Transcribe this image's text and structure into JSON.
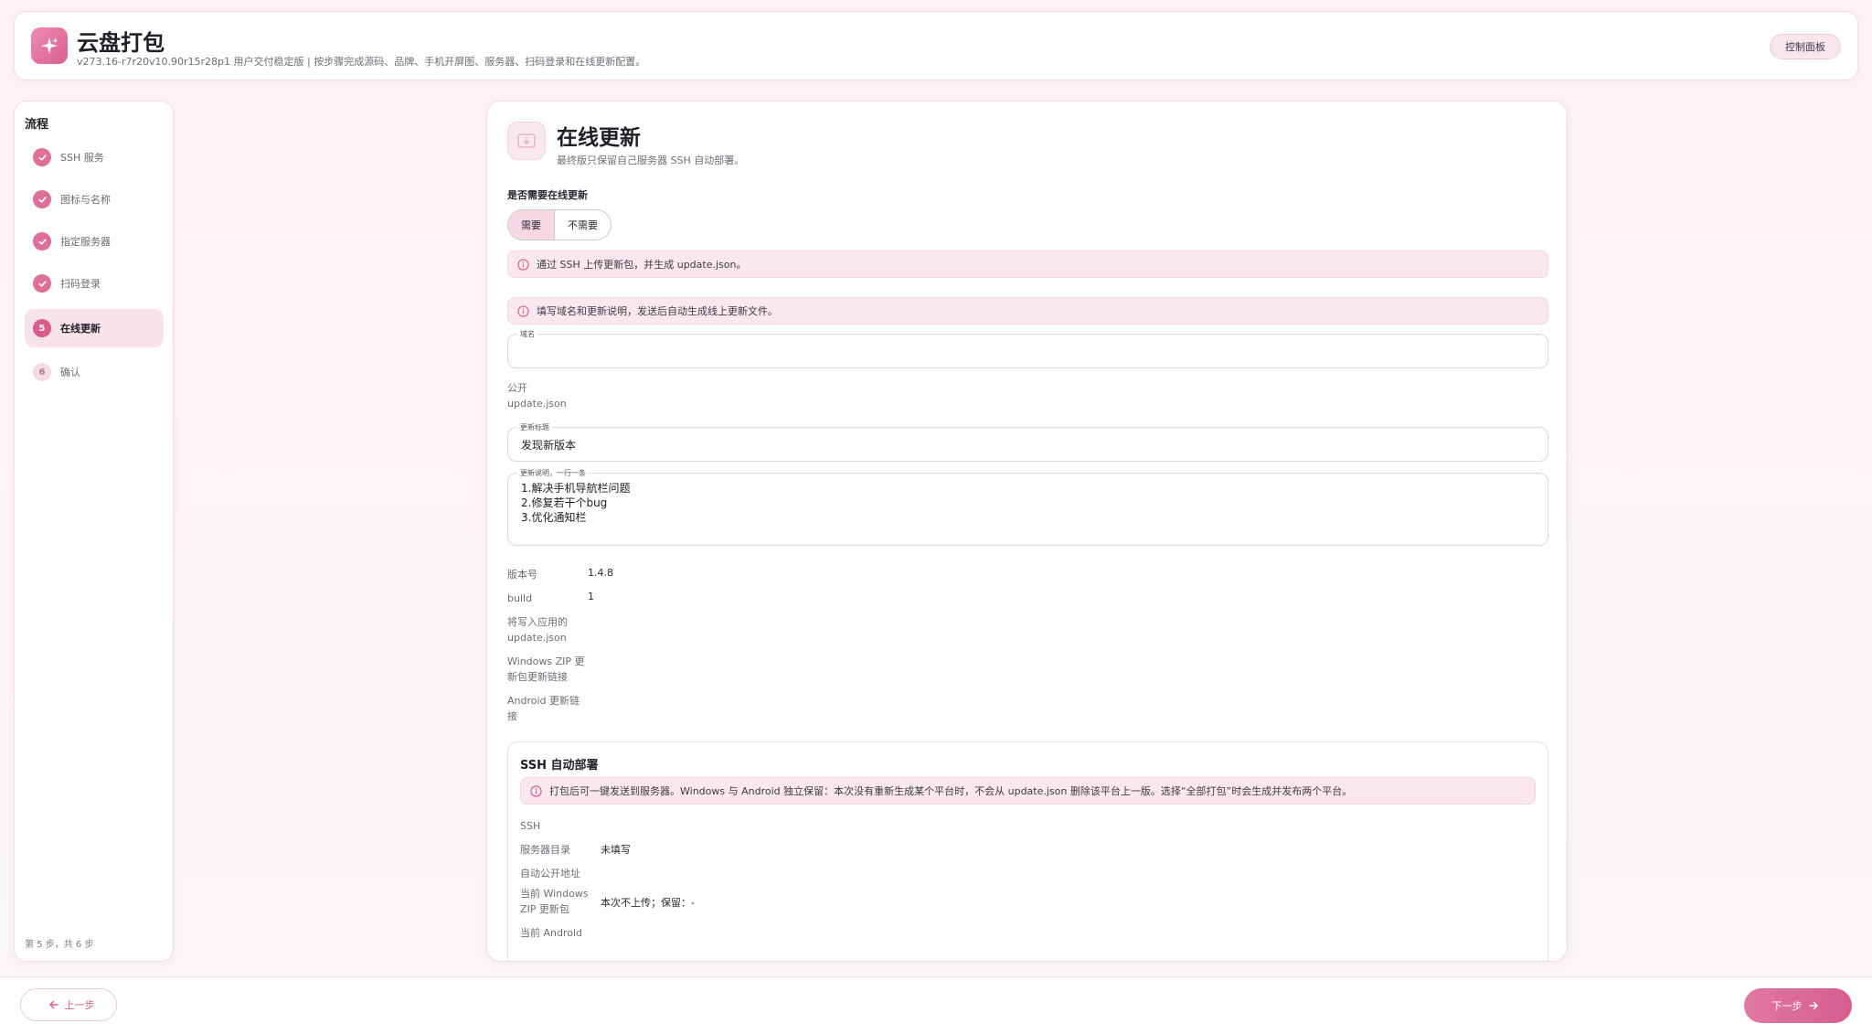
{
  "header": {
    "title": "云盘打包",
    "subtitle": "v273.16-r7r20v10.90r15r28p1 用户交付稳定版 | 按步骤完成源码、品牌、手机开屏图、服务器、扫码登录和在线更新配置。",
    "dashboard_label": "控制面板"
  },
  "sidebar": {
    "title": "流程",
    "steps": [
      {
        "label": "SSH 服务",
        "status": "done"
      },
      {
        "label": "图标与名称",
        "status": "done"
      },
      {
        "label": "指定服务器",
        "status": "done"
      },
      {
        "label": "扫码登录",
        "status": "done"
      },
      {
        "number": "5",
        "label": "在线更新",
        "status": "current"
      },
      {
        "number": "6",
        "label": "确认",
        "status": "todo"
      }
    ],
    "progress": "第 5 步，共 6 步"
  },
  "main": {
    "title": "在线更新",
    "subtitle": "最终版只保留自己服务器 SSH 自动部署。",
    "question": "是否需要在线更新",
    "options": [
      "需要",
      "不需要"
    ],
    "selected_option": "需要",
    "alert1": "通过 SSH 上传更新包，并生成 update.json。",
    "alert2": "填写域名和更新说明，发送后自动生成线上更新文件。",
    "domain_field": {
      "label": "域名",
      "value": ""
    },
    "public_label_line1": "公开",
    "public_label_line2": "update.json",
    "update_title_field": {
      "label": "更新标题",
      "value": "发现新版本"
    },
    "update_notes_field": {
      "label": "更新说明，一行一条",
      "lines": [
        "1.解决手机导航栏问题",
        "2.修复若干个bug",
        "3.优化通知栏"
      ]
    },
    "version_label": "版本号",
    "version_value": "1.4.8",
    "build_label": "build",
    "build_value": "1",
    "write_label_line1": "将写入应用的",
    "write_label_line2": "update.json",
    "win_label_line1": "Windows ZIP 更",
    "win_label_line2": "新包更新链接",
    "android_label_line1": "Android 更新链",
    "android_label_line2": "接"
  },
  "ssh": {
    "title": "SSH 自动部署",
    "alert": "打包后可一键发送到服务器。Windows 与 Android 独立保留：本次没有重新生成某个平台时，不会从 update.json 删除该平台上一版。选择“全部打包”时会生成并发布两个平台。",
    "ssh_label": "SSH",
    "dir_label": "服务器目录",
    "dir_value": "未填写",
    "auto_url_label": "自动公开地址",
    "win_zip_label_line1": "当前 Windows",
    "win_zip_label_line2": "ZIP 更新包",
    "win_zip_value": "本次不上传；保留：-",
    "android_label_line1": "当前 Android"
  },
  "footer": {
    "prev_label": "上一步",
    "next_label": "下一步"
  },
  "colors": {
    "accent": "#d95c8c",
    "accent_light": "#f8e3eb",
    "alert_bg": "#fbe8ef"
  }
}
